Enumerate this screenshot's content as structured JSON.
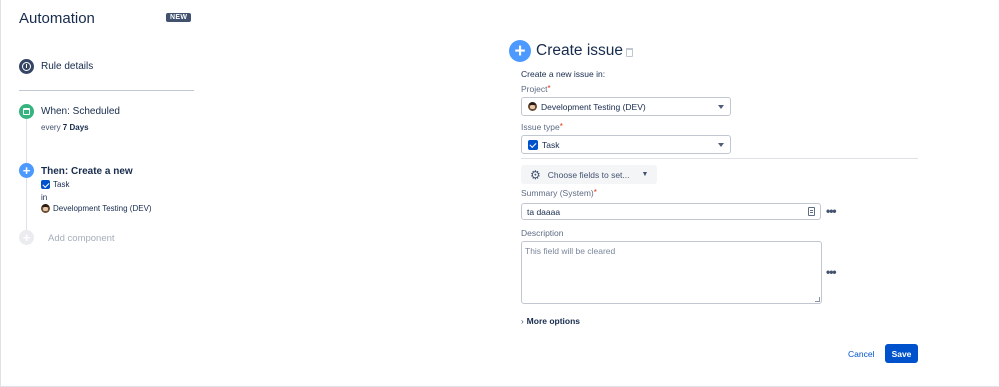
{
  "header": {
    "title": "Automation",
    "badge": "NEW"
  },
  "rule": {
    "details_label": "Rule details"
  },
  "trigger": {
    "label": "When: Scheduled",
    "every_prefix": "every",
    "every_value": "7 Days"
  },
  "action": {
    "label": "Then: Create a new",
    "issue_type": "Task",
    "in_label": "in",
    "project": "Development Testing (DEV)"
  },
  "add_component": {
    "label": "Add component"
  },
  "editor": {
    "title": "Create issue",
    "subtitle": "Create a new issue in:",
    "project_label": "Project",
    "project_value": "Development Testing (DEV)",
    "issue_type_label": "Issue type",
    "issue_type_value": "Task",
    "choose_fields_label": "Choose fields to set...",
    "summary_label": "Summary (System)",
    "summary_value": "ta daaaa",
    "description_label": "Description",
    "description_placeholder": "This field will be cleared",
    "more_options_label": "More options",
    "required_mark": "*"
  },
  "footer": {
    "cancel_label": "Cancel",
    "save_label": "Save"
  },
  "colors": {
    "primary": "#0052cc",
    "trigger_green": "#36b37e",
    "action_blue": "#4c9aff",
    "required_red": "#de350b"
  }
}
